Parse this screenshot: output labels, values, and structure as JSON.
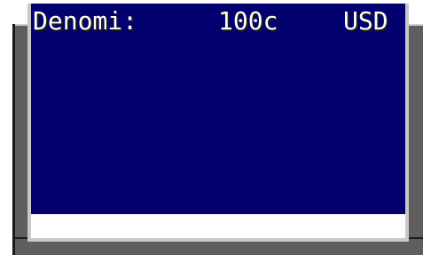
{
  "header": {
    "label": "Denomi:",
    "value": "100c",
    "currency": "USD"
  },
  "colors": {
    "screen_background": "#02016f",
    "text": "#ffffff",
    "frame": "#5e5e5e",
    "status_bar": "#ffffff"
  }
}
